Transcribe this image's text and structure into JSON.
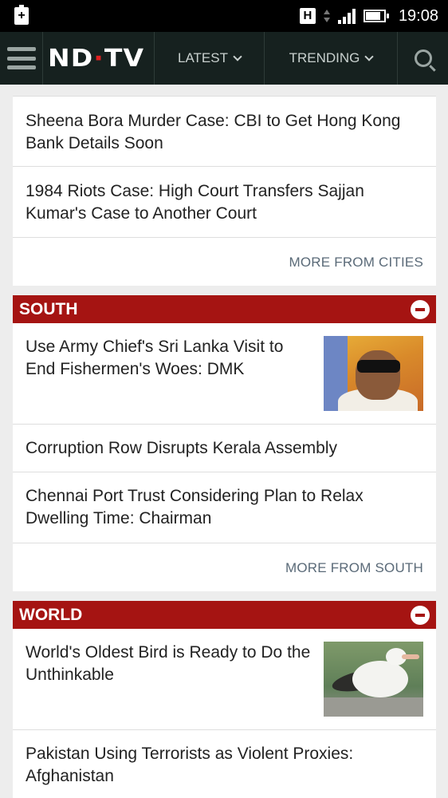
{
  "status_bar": {
    "time": "19:08",
    "network_icon_label": "H"
  },
  "nav": {
    "logo_main": "ND",
    "logo_mid": "T",
    "logo_end": "V",
    "latest_label": "LATEST",
    "trending_label": "TRENDING"
  },
  "cities": {
    "items": [
      {
        "title": "Sheena Bora Murder Case: CBI to Get Hong Kong Bank Details Soon"
      },
      {
        "title": "1984 Riots Case: High Court Transfers Sajjan Kumar's Case to Another Court"
      }
    ],
    "more_label": "MORE FROM CITIES"
  },
  "south": {
    "title": "SOUTH",
    "items": [
      {
        "title": "Use Army Chief's Sri Lanka Visit to End Fishermen's Woes: DMK",
        "has_thumb": true
      },
      {
        "title": "Corruption Row Disrupts Kerala Assembly"
      },
      {
        "title": "Chennai Port Trust Considering Plan to Relax Dwelling Time: Chairman"
      }
    ],
    "more_label": "MORE FROM SOUTH"
  },
  "world": {
    "title": "WORLD",
    "items": [
      {
        "title": "World's Oldest Bird is Ready to Do the Unthinkable",
        "has_thumb": true
      },
      {
        "title": "Pakistan Using Terrorists as Violent Proxies: Afghanistan"
      }
    ]
  },
  "colors": {
    "section_red": "#a51412",
    "nav_bg": "#16211f",
    "more_link": "#5a6a78"
  }
}
